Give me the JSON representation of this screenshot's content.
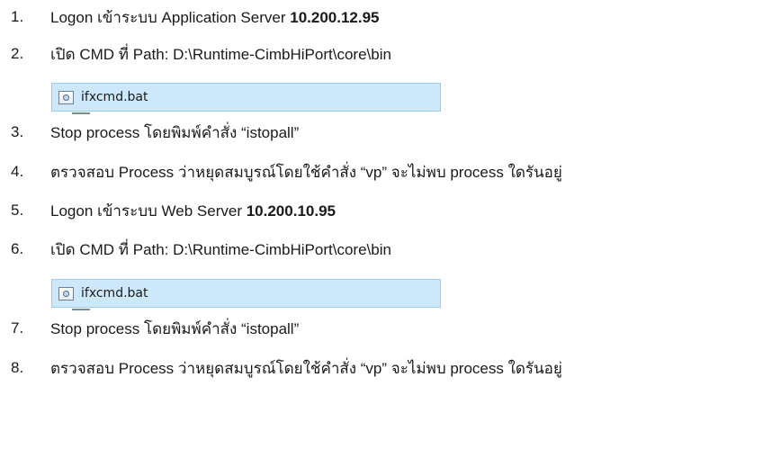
{
  "steps": [
    {
      "num": "1.",
      "text": "Logon เข้าระบบ Application Server ",
      "bold": "10.200.12.95"
    },
    {
      "num": "2.",
      "text": "เปิด CMD ที่ Path: D:\\Runtime-CimbHiPort\\core\\bin",
      "bold": ""
    },
    {
      "num": "3.",
      "text": "Stop process โดยพิมพ์คำสั่ง “istopall”",
      "bold": ""
    },
    {
      "num": "4.",
      "text": "ตรวจสอบ Process ว่าหยุดสมบูรณ์โดยใช้คำสั่ง “vp” จะไม่พบ process ใดรันอยู่",
      "bold": ""
    },
    {
      "num": "5.",
      "text": "Logon เข้าระบบ Web Server ",
      "bold": "10.200.10.95"
    },
    {
      "num": "6.",
      "text": "เปิด CMD ที่ Path: D:\\Runtime-CimbHiPort\\core\\bin",
      "bold": ""
    },
    {
      "num": "7.",
      "text": "Stop process โดยพิมพ์คำสั่ง “istopall”",
      "bold": ""
    },
    {
      "num": "8.",
      "text": "ตรวจสอบ Process ว่าหยุดสมบูรณ์โดยใช้คำสั่ง “vp” จะไม่พบ process ใดรันอยู่",
      "bold": ""
    }
  ],
  "files": [
    {
      "name": "ifxcmd.bat",
      "icon": "batch-file-icon"
    },
    {
      "name": "ifxcmd.bat",
      "icon": "batch-file-icon"
    }
  ]
}
